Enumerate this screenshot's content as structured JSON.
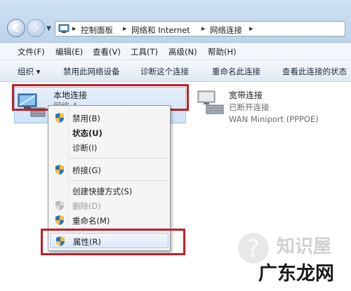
{
  "breadcrumb": [
    "控制面板",
    "网络和 Internet",
    "网络连接"
  ],
  "menu": [
    "文件(F)",
    "编辑(E)",
    "查看(V)",
    "工具(T)",
    "高级(N)",
    "帮助(H)"
  ],
  "commands": {
    "organize": "组织 ▾",
    "disable": "禁用此网络设备",
    "diagnose": "诊断这个连接",
    "rename": "重命名此连接",
    "status": "查看此连接的状态"
  },
  "connections": {
    "local": {
      "name": "本地连接",
      "sub": "网络 4"
    },
    "broadband": {
      "name": "宽带连接",
      "status": "已断开连接",
      "device": "WAN Miniport (PPPOE)"
    }
  },
  "context_menu": {
    "disable": "禁用(B)",
    "status": "状态(U)",
    "diagnose": "诊断(I)",
    "bridge": "桥接(G)",
    "shortcut": "创建快捷方式(S)",
    "delete": "删除(D)",
    "rename": "重命名(M)",
    "properties": "属性(R)"
  },
  "watermark": {
    "line1": "知识屋",
    "line2": "广东龙网"
  },
  "colors": {
    "highlight_box": "#c21e26",
    "selection": "#cfe2f7"
  }
}
